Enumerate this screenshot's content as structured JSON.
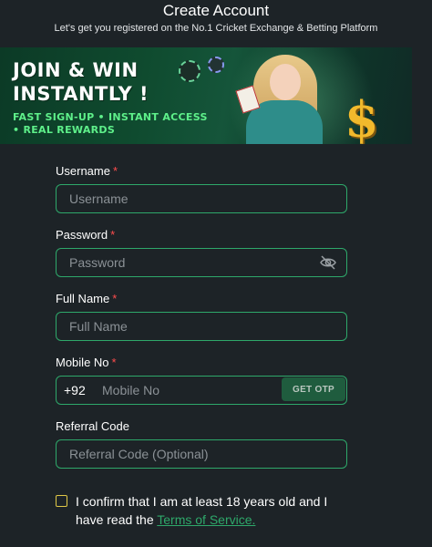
{
  "header": {
    "title": "Create Account",
    "subtitle": "Let's get you registered on the No.1 Cricket Exchange & Betting Platform"
  },
  "banner": {
    "headline_line1": "JOIN & WIN",
    "headline_line2": "INSTANTLY !",
    "tagline_line1": "FAST SIGN-UP • INSTANT ACCESS",
    "tagline_line2": "• REAL REWARDS",
    "dollar_glyph": "$",
    "accent_color": "#5ef08a"
  },
  "form": {
    "username": {
      "label": "Username",
      "required_mark": "*",
      "placeholder": "Username",
      "value": ""
    },
    "password": {
      "label": "Password",
      "required_mark": "*",
      "placeholder": "Password",
      "value": "",
      "toggle_icon": "eye-off-icon"
    },
    "full_name": {
      "label": "Full Name",
      "required_mark": "*",
      "placeholder": "Full Name",
      "value": ""
    },
    "mobile": {
      "label": "Mobile No",
      "required_mark": "*",
      "country_code": "+92",
      "placeholder": "Mobile No",
      "value": "",
      "otp_button": "GET OTP"
    },
    "referral": {
      "label": "Referral Code",
      "placeholder": "Referral Code (Optional)",
      "value": ""
    }
  },
  "consent": {
    "text": "I confirm that I am at least 18 years old and I have read the",
    "link": "Terms of Service.",
    "checked": false
  },
  "colors": {
    "background": "#1d2327",
    "field_border": "#2ea86a",
    "required": "#ff4d4d",
    "checkbox_border": "#e0c847"
  }
}
